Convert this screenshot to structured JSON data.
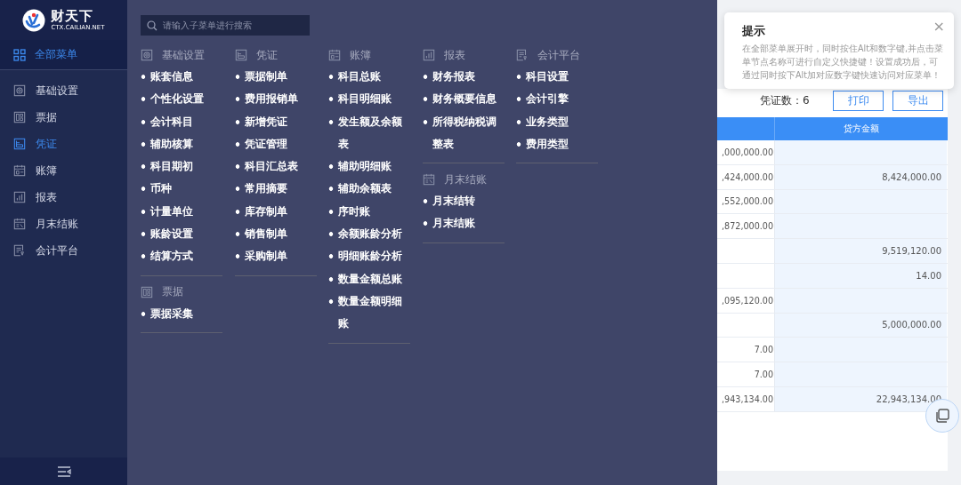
{
  "logo": {
    "name": "财天下",
    "domain": "CTX.CAILIAN.NET"
  },
  "all_menu": {
    "label": "全部菜单",
    "active": true
  },
  "sidebar": {
    "items": [
      {
        "label": "基础设置",
        "kind": "settings",
        "selected": false
      },
      {
        "label": "票据",
        "kind": "receipt",
        "selected": false
      },
      {
        "label": "凭证",
        "kind": "voucher",
        "selected": true
      },
      {
        "label": "账簿",
        "kind": "ledger",
        "selected": false
      },
      {
        "label": "报表",
        "kind": "report",
        "selected": false
      },
      {
        "label": "月末结账",
        "kind": "closing",
        "selected": false
      },
      {
        "label": "会计平台",
        "kind": "platform",
        "selected": false
      }
    ]
  },
  "menu_panel": {
    "search": {
      "placeholder": "请输入子菜单进行搜索"
    },
    "columns": [
      [
        {
          "title": "基础设置",
          "kind": "settings",
          "items": [
            "账套信息",
            "个性化设置",
            "会计科目",
            "辅助核算",
            "科目期初",
            "币种",
            "计量单位",
            "账龄设置",
            "结算方式"
          ]
        },
        {
          "title": "票据",
          "kind": "receipt",
          "items": [
            "票据采集"
          ]
        }
      ],
      [
        {
          "title": "凭证",
          "kind": "voucher",
          "items": [
            "票据制单",
            "费用报销单",
            "新增凭证",
            "凭证管理",
            "科目汇总表",
            "常用摘要",
            "库存制单",
            "销售制单",
            "采购制单"
          ]
        }
      ],
      [
        {
          "title": "账簿",
          "kind": "ledger",
          "items": [
            "科目总账",
            "科目明细账",
            "发生额及余额表",
            "辅助明细账",
            "辅助余额表",
            "序时账",
            "余额账龄分析",
            "明细账龄分析",
            "数量金额总账",
            "数量金额明细账"
          ]
        }
      ],
      [
        {
          "title": "报表",
          "kind": "report",
          "items": [
            "财务报表",
            "财务概要信息",
            "所得税纳税调整表"
          ]
        },
        {
          "title": "月末结账",
          "kind": "closing",
          "items": [
            "月末结转",
            "月末结账"
          ]
        }
      ],
      [
        {
          "title": "会计平台",
          "kind": "platform",
          "items": [
            "科目设置",
            "会计引擎",
            "业务类型",
            "费用类型"
          ]
        }
      ]
    ]
  },
  "tip": {
    "title": "提示",
    "close": "×",
    "text": "在全部菜单展开时，同时按住Alt和数字键,并点击菜单节点名称可进行自定义快捷键！设置成功后，可通过同时按下Alt加对应数字键快速访问对应菜单！"
  },
  "toolbar": {
    "voucher_count": "凭证数：6",
    "buttons": [
      "打印",
      "导出"
    ]
  },
  "table": {
    "columns": [
      "",
      "贷方金额"
    ],
    "rows": [
      [
        ",000,000.00",
        ""
      ],
      [
        ",424,000.00",
        "8,424,000.00"
      ],
      [
        ",552,000.00",
        ""
      ],
      [
        ",872,000.00",
        ""
      ],
      [
        "",
        "9,519,120.00"
      ],
      [
        "",
        "14.00"
      ],
      [
        ",095,120.00",
        ""
      ],
      [
        "",
        "5,000,000.00"
      ],
      [
        "7.00",
        ""
      ],
      [
        "7.00",
        ""
      ],
      [
        ",943,134.00",
        "22,943,134.00"
      ]
    ]
  }
}
